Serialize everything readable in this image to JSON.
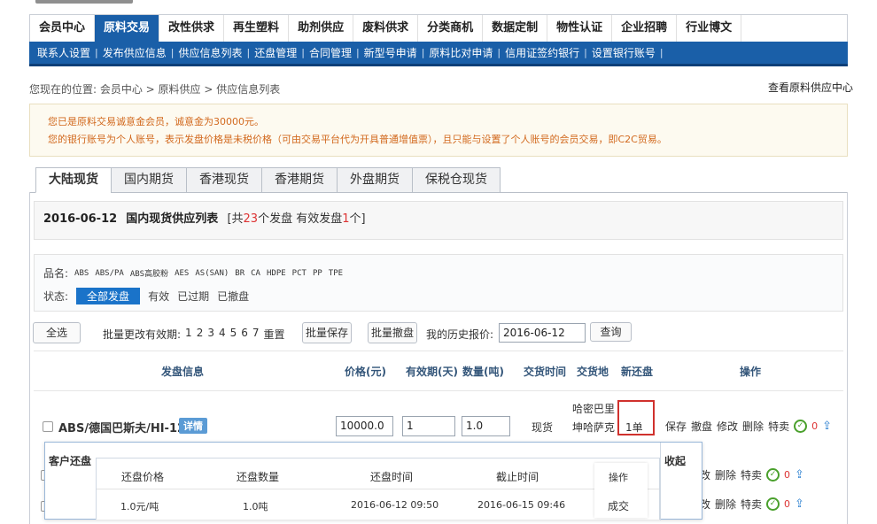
{
  "nav": {
    "items": [
      "会员中心",
      "原料交易",
      "改性供求",
      "再生塑料",
      "助剂供应",
      "废料供求",
      "分类商机",
      "数据定制",
      "物性认证",
      "企业招聘",
      "行业博文"
    ],
    "active_index": 1
  },
  "subnav": {
    "items": [
      "联系人设置",
      "发布供应信息",
      "供应信息列表",
      "还盘管理",
      "合同管理",
      "新型号申请",
      "原料比对申请",
      "信用证签约银行",
      "设置银行账号"
    ]
  },
  "breadcrumb": {
    "text": "您现在的位置: 会员中心 > 原料供应 > 供应信息列表"
  },
  "view_center": "查看原料供应中心",
  "notice": {
    "line1": "您已是原料交易诚意金会员，诚意金为30000元。",
    "line2": "您的银行账号为个人账号，表示发盘价格是未税价格（可由交易平台代为开具普通增值票），且只能与设置了个人账号的会员交易，即C2C贸易。"
  },
  "tabs": [
    "大陆现货",
    "国内期货",
    "香港现货",
    "香港期货",
    "外盘期货",
    "保税仓现货"
  ],
  "list_header": {
    "date": "2016-06-12",
    "title": "国内现货供应列表",
    "summary_pre": "[共",
    "total": "23",
    "summary_mid": "个发盘 有效发盘",
    "valid": "1",
    "summary_post": "个]"
  },
  "filter": {
    "name_label": "品名:",
    "products": [
      "ABS",
      "ABS/PA",
      "ABS高胶粉",
      "AES",
      "AS(SAN)",
      "BR",
      "CA",
      "HDPE",
      "PCT",
      "PP",
      "TPE"
    ],
    "status_label": "状态:",
    "status": [
      "全部发盘",
      "有效",
      "已过期",
      "已撤盘"
    ]
  },
  "toolbar": {
    "select_all": "全选",
    "batch_label": "批量更改有效期:",
    "days": [
      "1",
      "2",
      "3",
      "4",
      "5",
      "6",
      "7"
    ],
    "reset": "重置",
    "batch_save": "批量保存",
    "batch_withdraw": "批量撤盘",
    "history_label": "我的历史报价:",
    "history_date": "2016-06-12",
    "query": "查询"
  },
  "table_head": {
    "offer_info": "发盘信息",
    "price": "价格(元)",
    "validity": "有效期(天)",
    "quantity": "数量(吨)",
    "delivery_time": "交货时间",
    "delivery_place": "交货地",
    "new_counter": "新还盘",
    "ops": "操作"
  },
  "row": {
    "product": "ABS/德国巴斯夫/HI-12",
    "detail": "详情",
    "price": "10000.0",
    "validity": "1",
    "quantity": "1.0",
    "delivery_time": "现货",
    "delivery_place_1": "哈密巴里",
    "delivery_place_2": "坤哈萨克",
    "new_counter": "1单",
    "ops": [
      "保存",
      "撤盘",
      "修改",
      "删除",
      "特卖"
    ],
    "count": "0"
  },
  "hidden_rows": {
    "ops_a": [
      "改",
      "删除",
      "特卖"
    ],
    "ops_b": [
      "改",
      "删除",
      "特卖"
    ],
    "count": "0"
  },
  "popup": {
    "title": "客户还盘",
    "collapse": "收起",
    "headers": [
      "还盘价格",
      "还盘数量",
      "还盘时间",
      "截止时间",
      "操作"
    ],
    "row": [
      "1.0元/吨",
      "1.0吨",
      "2016-06-12 09:50",
      "2016-06-15 09:46",
      "成交"
    ]
  },
  "colors": {
    "nav_blue": "#1a5fa8",
    "notice_text": "#d2691e",
    "highlight_red": "#d0312d",
    "check_green": "#4aa02c"
  }
}
